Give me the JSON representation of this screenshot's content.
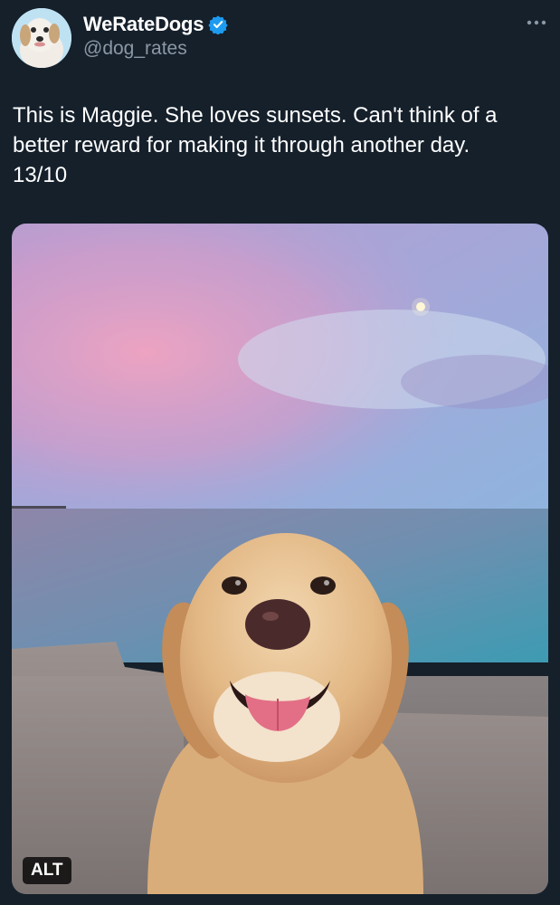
{
  "tweet": {
    "author": {
      "display_name": "WeRateDogs",
      "handle": "@dog_rates",
      "verified": true,
      "avatar_icon": "dog-avatar-icon",
      "verified_icon": "verified-badge-icon",
      "verified_color": "#1d9bf0"
    },
    "more_icon": "more-options-icon",
    "text": "This is Maggie. She loves sunsets. Can't think of a\nbetter reward for making it through another day.\n13/10",
    "media": {
      "type": "photo",
      "alt_badge": "ALT"
    }
  },
  "theme": {
    "background": "#15202b",
    "text_primary": "#ffffff",
    "text_secondary": "#8b98a5"
  }
}
